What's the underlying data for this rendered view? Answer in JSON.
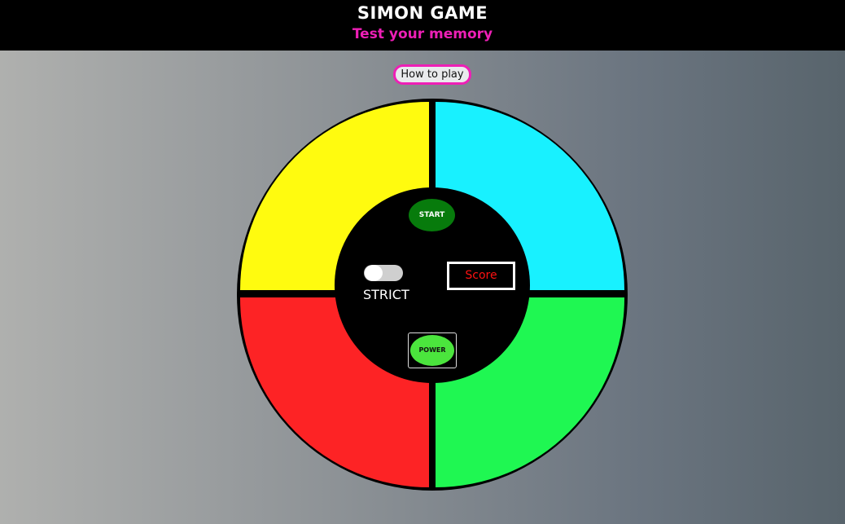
{
  "header": {
    "title": "SIMON GAME",
    "subtitle": "Test your memory"
  },
  "help_button": {
    "label": "How to play"
  },
  "board": {
    "pads": [
      {
        "name": "yellow",
        "color": "#fffb0f"
      },
      {
        "name": "cyan",
        "color": "#18f1ff"
      },
      {
        "name": "red",
        "color": "#fd2325"
      },
      {
        "name": "green",
        "color": "#1ff752"
      }
    ]
  },
  "controls": {
    "start_label": "START",
    "strict_label": "STRICT",
    "strict_on": false,
    "score_label": "Score",
    "power_label": "POWER"
  },
  "colors": {
    "accent": "#ee1fb6",
    "score_text": "#ff1111",
    "start": "#077b0c",
    "power": "#4be53d"
  }
}
